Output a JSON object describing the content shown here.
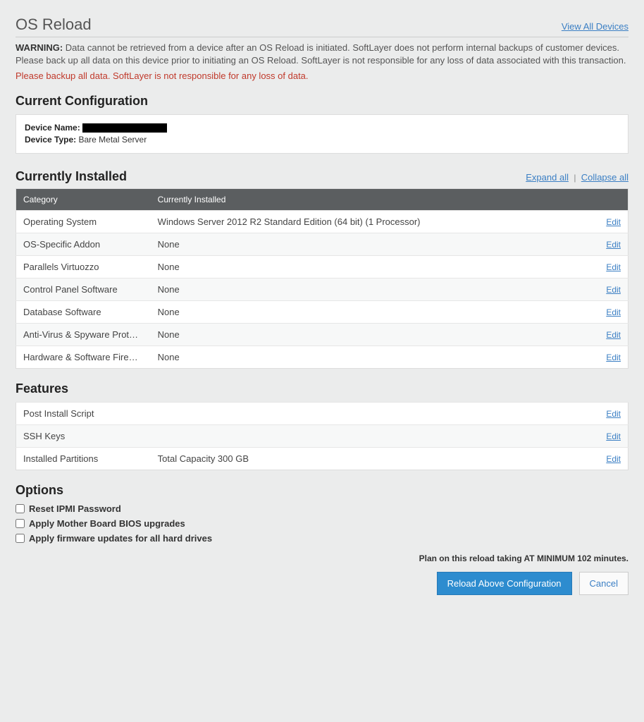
{
  "header": {
    "title": "OS Reload",
    "view_all_link": "View All Devices"
  },
  "warning": {
    "label": "WARNING:",
    "text": "Data cannot be retrieved from a device after an OS Reload is initiated. SoftLayer does not perform internal backups of customer devices. Please back up all data on this device prior to initiating an OS Reload. SoftLayer is not responsible for any loss of data associated with this transaction."
  },
  "backup_warning": "Please backup all data. SoftLayer is not responsible for any loss of data.",
  "current_config": {
    "title": "Current Configuration",
    "device_name_label": "Device Name:",
    "device_type_label": "Device Type:",
    "device_type_value": "Bare Metal Server"
  },
  "currently_installed": {
    "title": "Currently Installed",
    "expand": "Expand all",
    "collapse": "Collapse all",
    "col_category": "Category",
    "col_installed": "Currently Installed",
    "edit_label": "Edit",
    "rows": [
      {
        "category": "Operating System",
        "value": "Windows Server 2012 R2 Standard Edition (64 bit) (1 Processor)"
      },
      {
        "category": "OS-Specific Addon",
        "value": "None"
      },
      {
        "category": "Parallels Virtuozzo",
        "value": "None"
      },
      {
        "category": "Control Panel Software",
        "value": "None"
      },
      {
        "category": "Database Software",
        "value": "None"
      },
      {
        "category": "Anti-Virus & Spyware Protection",
        "value": "None"
      },
      {
        "category": "Hardware & Software Firewalls",
        "value": "None"
      }
    ]
  },
  "features": {
    "title": "Features",
    "edit_label": "Edit",
    "rows": [
      {
        "category": "Post Install Script",
        "value": ""
      },
      {
        "category": "SSH Keys",
        "value": ""
      },
      {
        "category": "Installed Partitions",
        "value": "Total Capacity 300 GB"
      }
    ]
  },
  "options": {
    "title": "Options",
    "items": [
      "Reset IPMI Password",
      "Apply Mother Board BIOS upgrades",
      "Apply firmware updates for all hard drives"
    ]
  },
  "plan_note": "Plan on this reload taking AT MINIMUM 102 minutes.",
  "buttons": {
    "reload": "Reload Above Configuration",
    "cancel": "Cancel"
  }
}
